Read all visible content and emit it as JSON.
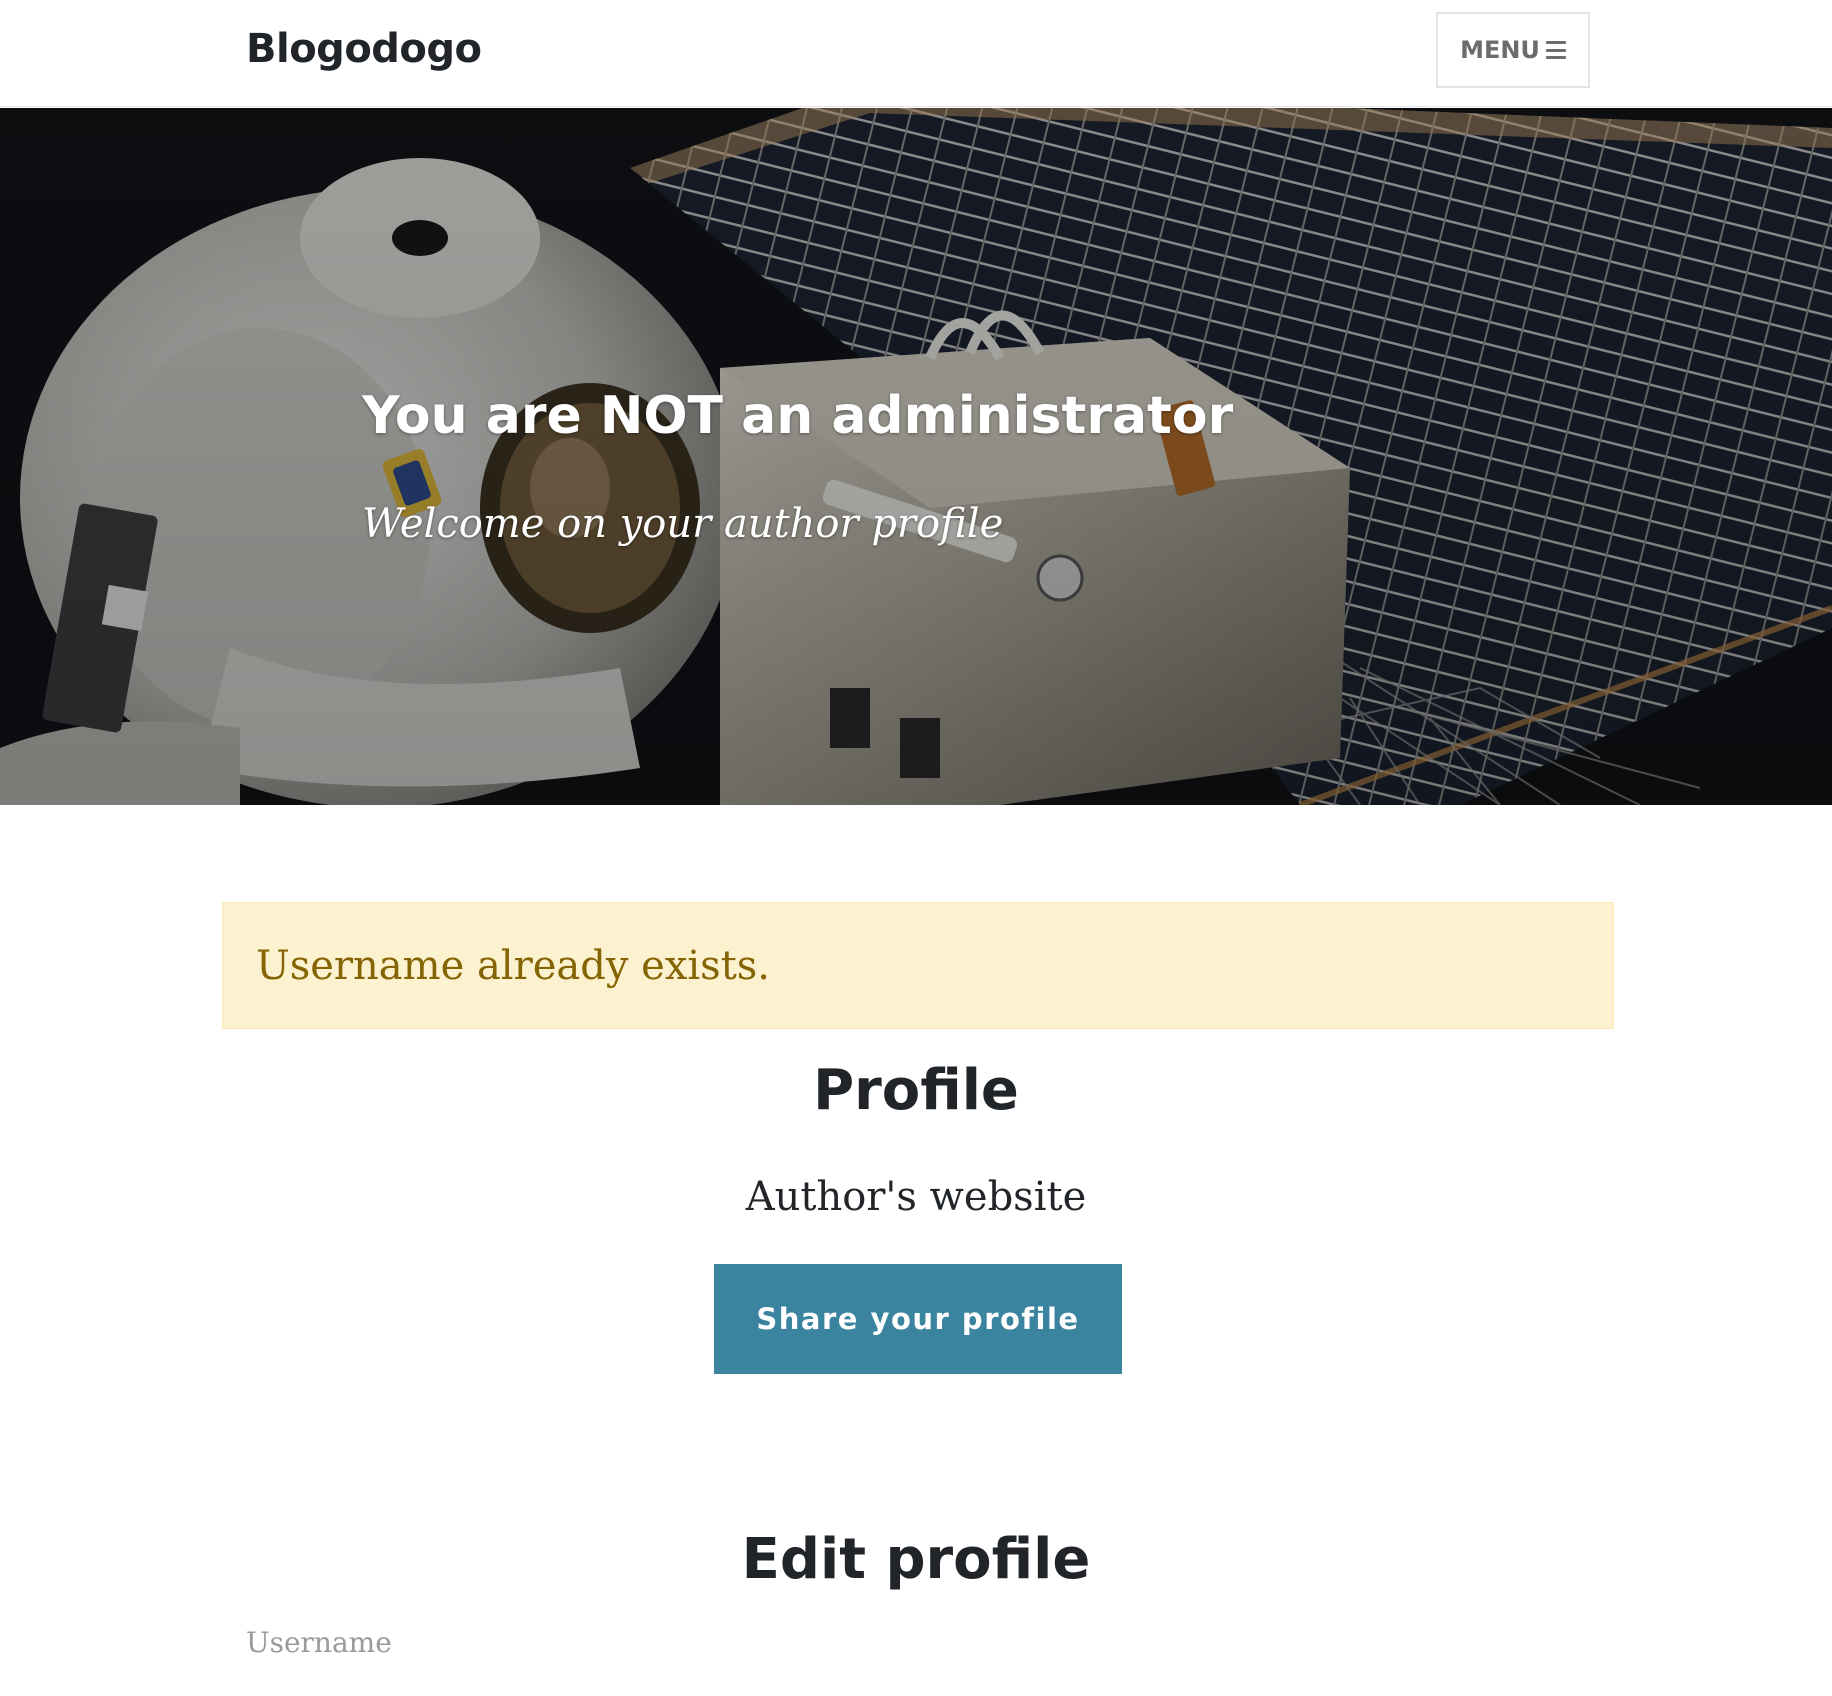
{
  "navbar": {
    "brand": "Blogodogo",
    "menu_label": "MENU",
    "menu_icon": "bars-icon"
  },
  "hero": {
    "title": "You are NOT an administrator",
    "subtitle": "Welcome on your author profile",
    "background_image": "astronaut spacewalk beside solar panel array"
  },
  "alert": {
    "message": "Username already exists.",
    "background_color": "#fdf2cf",
    "text_color": "#856404"
  },
  "profile": {
    "heading": "Profile",
    "website_label": "Author's website",
    "share_button_label": "Share your profile",
    "share_button_color": "#3a84a0"
  },
  "edit_profile": {
    "heading": "Edit profile",
    "username_label": "Username"
  }
}
